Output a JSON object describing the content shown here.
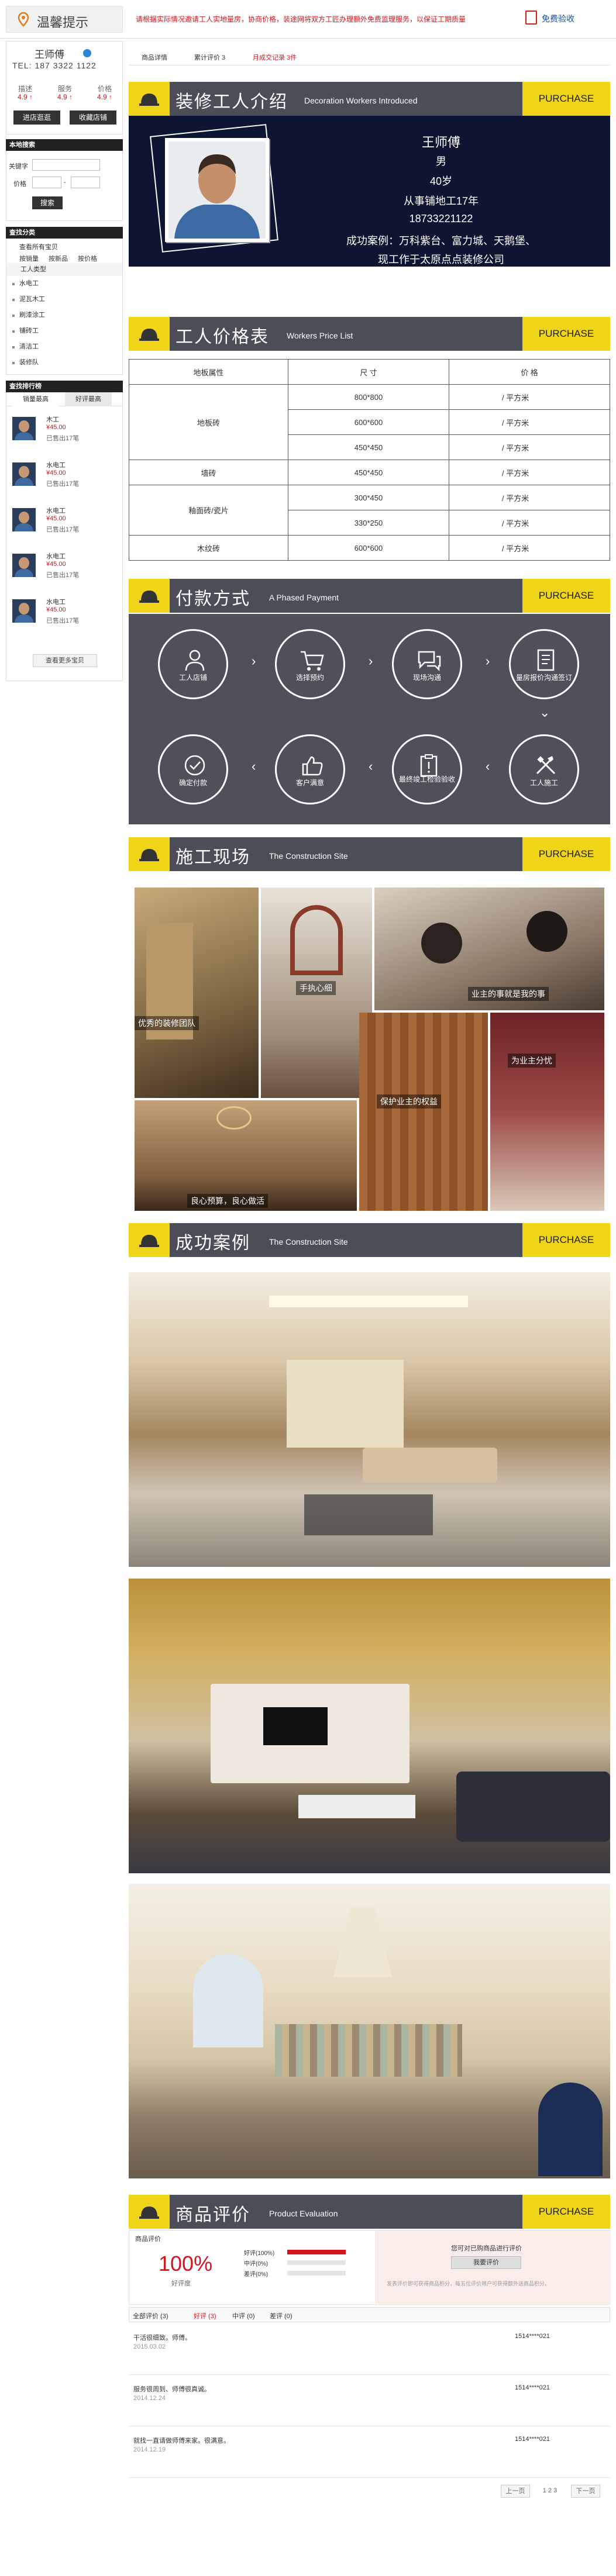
{
  "topbar": {
    "title": "温馨提示",
    "notice": "请根据实际情况邀请工人实地量房，协商价格，装途网将双方工匠办理额外免费监理服务，以保证工期质量",
    "free_inspect": "免费验收",
    "icon_pin": "location-pin-icon",
    "icon_doc": "document-icon"
  },
  "shop": {
    "name": "王师傅",
    "tel": "TEL: 187 3322 1122",
    "ratings": [
      {
        "label": "描述",
        "value": "4.9 ↑"
      },
      {
        "label": "服务",
        "value": "4.9 ↑"
      },
      {
        "label": "价格",
        "value": "4.9 ↑"
      }
    ],
    "btn_enter": "进店逛逛",
    "btn_fav": "收藏店铺"
  },
  "search": {
    "header": "本地搜索",
    "kw_label": "关键字",
    "price_label": "价格",
    "dash": "-",
    "btn": "搜索"
  },
  "category": {
    "header": "查找分类",
    "links": [
      "查看所有宝贝",
      "按销量",
      "按新品",
      "按价格"
    ],
    "title": "工人类型",
    "items": [
      "水电工",
      "泥瓦木工",
      "刷漆涂工",
      "铺砖工",
      "清洁工",
      "装修队"
    ]
  },
  "rank": {
    "header": "查找排行榜",
    "tabs": [
      "销量最高",
      "好评最高"
    ],
    "items": [
      {
        "title": "木工",
        "price": "¥45.00",
        "sold": "已售出17笔"
      },
      {
        "title": "水电工",
        "price": "¥45.00",
        "sold": "已售出17笔"
      },
      {
        "title": "水电工",
        "price": "¥45.00",
        "sold": "已售出17笔"
      },
      {
        "title": "水电工",
        "price": "¥45.00",
        "sold": "已售出17笔"
      },
      {
        "title": "水电工",
        "price": "¥45.00",
        "sold": "已售出17笔"
      }
    ],
    "more": "查看更多宝贝"
  },
  "tabs": {
    "detail": "商品详情",
    "reviews": "累计评价 3",
    "deals": "月成交记录 3件"
  },
  "sections": {
    "purchase": "PURCHASE",
    "intro_cn": "装修工人介绍",
    "intro_en": "Decoration Workers Introduced",
    "price_cn": "工人价格表",
    "price_en": "Workers Price List",
    "pay_cn": "付款方式",
    "pay_en": "A Phased Payment",
    "site_cn": "施工现场",
    "site_en": "The Construction Site",
    "case_cn": "成功案例",
    "case_en": "The Construction Site",
    "eval_cn": "商品评价",
    "eval_en": "Product Evaluation"
  },
  "intro": {
    "name": "王师傅",
    "gender": "男",
    "age": "40岁",
    "exp": "从事铺地工17年",
    "phone": "18733221122",
    "cases": "成功案例：万科紫台、富力城、天鹅堡、",
    "company": "现工作于太原点点装修公司"
  },
  "price_table": {
    "headers": [
      "地板属性",
      "尺 寸",
      "价 格"
    ],
    "rows": [
      {
        "type": "地板砖",
        "size": "800*800",
        "price": "/ 平方米"
      },
      {
        "type": "",
        "size": "600*600",
        "price": "/ 平方米"
      },
      {
        "type": "",
        "size": "450*450",
        "price": "/ 平方米"
      },
      {
        "type": "墙砖",
        "size": "450*450",
        "price": "/ 平方米"
      },
      {
        "type": "釉面砖/瓷片",
        "size": "300*450",
        "price": "/ 平方米"
      },
      {
        "type": "",
        "size": "330*250",
        "price": "/ 平方米"
      },
      {
        "type": "木纹砖",
        "size": "600*600",
        "price": "/ 平方米"
      }
    ]
  },
  "payment_steps": {
    "top": [
      "工人店铺",
      "选择预约",
      "现场沟通",
      "量房报价沟通签订"
    ],
    "bottom": [
      "确定付款",
      "客户满意",
      "最终竣工检验验收",
      "工人施工"
    ],
    "arrow_right": "›",
    "arrow_left": "‹",
    "arrow_down": "⌄"
  },
  "site_captions": [
    "手执心细",
    "业主的事就是我的事",
    "优秀的装修团队",
    "为业主分忧",
    "保护业主的权益",
    "良心预算，良心做活"
  ],
  "evaluation": {
    "title": "商品评价",
    "percent": "100%",
    "good_label": "好评度",
    "bars": [
      {
        "label": "好评(100%)",
        "value": 1.0
      },
      {
        "label": "中评(0%)",
        "value": 0
      },
      {
        "label": "差评(0%)",
        "value": 0
      }
    ],
    "buy_hint": "您可对已购商品进行评价",
    "btn": "我要评价",
    "note": "发表评价即可获得商品积分，每五位评价用户可获得额外送商品积分。",
    "tabs": [
      "全部评价 (3)",
      "好评 (3)",
      "中评 (0)",
      "差评 (0)"
    ],
    "reviews": [
      {
        "text": "干活很细致。师傅。",
        "date": "2015.03.02",
        "user": "1514****021"
      },
      {
        "text": "服务很周到、师傅很真诚。",
        "date": "2014.12.24",
        "user": "1514****021"
      },
      {
        "text": "就找一直请做师傅来家。很满意。",
        "date": "2014.12.19",
        "user": "1514****021"
      }
    ],
    "pager": {
      "prev": "上一页",
      "pages": "1 2 3",
      "next": "下一页"
    }
  },
  "colors": {
    "accent_yellow": "#efd417",
    "banner_gray": "#4b4d57",
    "navy": "#0d1533",
    "red": "#d4141e"
  }
}
